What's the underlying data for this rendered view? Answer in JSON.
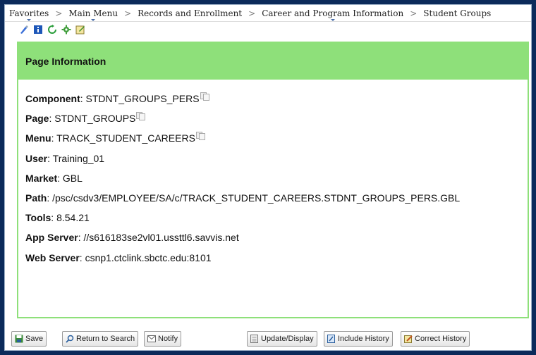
{
  "breadcrumb": [
    {
      "label": "Favorites",
      "menu": true
    },
    {
      "label": "Main Menu",
      "menu": true
    },
    {
      "label": "Records and Enrollment",
      "menu": false
    },
    {
      "label": "Career and Program Information",
      "menu": true
    },
    {
      "label": "Student Groups",
      "menu": false
    }
  ],
  "breadcrumb_separator": ">",
  "toolbar_icons": [
    "new-window-icon",
    "help-icon",
    "refresh-icon",
    "personalize-gear-icon",
    "page-notes-icon"
  ],
  "panel": {
    "title": "Page Information",
    "rows": [
      {
        "key": "Component",
        "value": "STDNT_GROUPS_PERS",
        "copy": true
      },
      {
        "key": "Page",
        "value": "STDNT_GROUPS",
        "copy": true
      },
      {
        "key": "Menu",
        "value": "TRACK_STUDENT_CAREERS",
        "copy": true
      },
      {
        "key": "User",
        "value": "Training_01",
        "copy": false
      },
      {
        "key": "Market",
        "value": "GBL",
        "copy": false
      },
      {
        "key": "Path",
        "value": "/psc/csdv3/EMPLOYEE/SA/c/TRACK_STUDENT_CAREERS.STDNT_GROUPS_PERS.GBL",
        "copy": false
      },
      {
        "key": "Tools",
        "value": "8.54.21",
        "copy": false
      },
      {
        "key": "App Server",
        "value": "//s616183se2vl01.ussttl6.savvis.net",
        "copy": false
      },
      {
        "key": "Web Server",
        "value": "csnp1.ctclink.sbctc.edu:8101",
        "copy": false
      }
    ]
  },
  "buttons": {
    "save": "Save",
    "return_to_search": "Return to Search",
    "notify": "Notify",
    "update_display": "Update/Display",
    "include_history": "Include History",
    "correct_history": "Correct History"
  },
  "colors": {
    "panel_green": "#8ee07a",
    "frame_navy": "#0b2a5a"
  }
}
